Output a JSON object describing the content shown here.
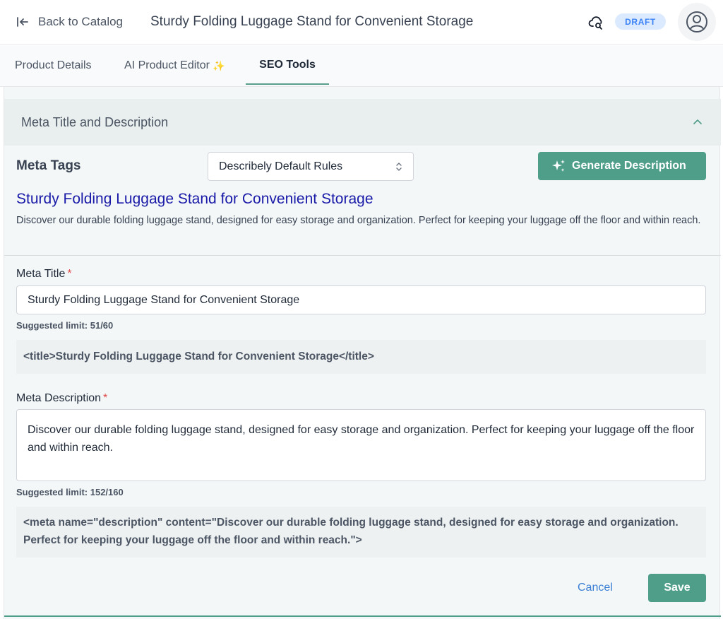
{
  "header": {
    "back_label": "Back to Catalog",
    "title": "Sturdy Folding Luggage Stand for Convenient Storage",
    "status_badge": "DRAFT"
  },
  "tabs": [
    {
      "label": "Product Details",
      "active": false
    },
    {
      "label": "AI Product Editor",
      "suffix": "✨",
      "active": false
    },
    {
      "label": "SEO Tools",
      "active": true
    }
  ],
  "accordion": {
    "title": "Meta Title and Description",
    "expanded": true
  },
  "meta_tags": {
    "label": "Meta Tags",
    "rules_select_value": "Describely Default Rules",
    "generate_button": "Generate Description"
  },
  "preview": {
    "title": "Sturdy Folding Luggage Stand for Convenient Storage",
    "description": "Discover our durable folding luggage stand, designed for easy storage and organization. Perfect for keeping your luggage off the floor and within reach."
  },
  "meta_title": {
    "label": "Meta Title",
    "required_mark": "*",
    "value": "Sturdy Folding Luggage Stand for Convenient Storage",
    "limit_text": "Suggested limit: 51/60",
    "code_preview": "<title>Sturdy Folding Luggage Stand for Convenient Storage</title>"
  },
  "meta_description": {
    "label": "Meta Description",
    "required_mark": "*",
    "value": "Discover our durable folding luggage stand, designed for easy storage and organization. Perfect for keeping your luggage off the floor and within reach.",
    "limit_text": "Suggested limit: 152/160",
    "code_preview": "<meta name=\"description\" content=\"Discover our durable folding luggage stand, designed for easy storage and organization. Perfect for keeping your luggage off the floor and within reach.\">"
  },
  "actions": {
    "cancel_label": "Cancel",
    "save_label": "Save"
  },
  "icons": {
    "back": "back-arrow-icon",
    "cloud": "cloud-search-icon",
    "avatar": "user-avatar-icon",
    "chevron": "chevron-up-icon",
    "select": "up-down-chevron-icon",
    "sparkle": "sparkles-icon"
  },
  "colors": {
    "accent": "#4f9e8a",
    "badge_bg": "#dbeafe",
    "badge_text": "#3b82f6",
    "preview_title": "#1a1aa8",
    "required": "#e04848",
    "link": "#3b7fd4"
  }
}
